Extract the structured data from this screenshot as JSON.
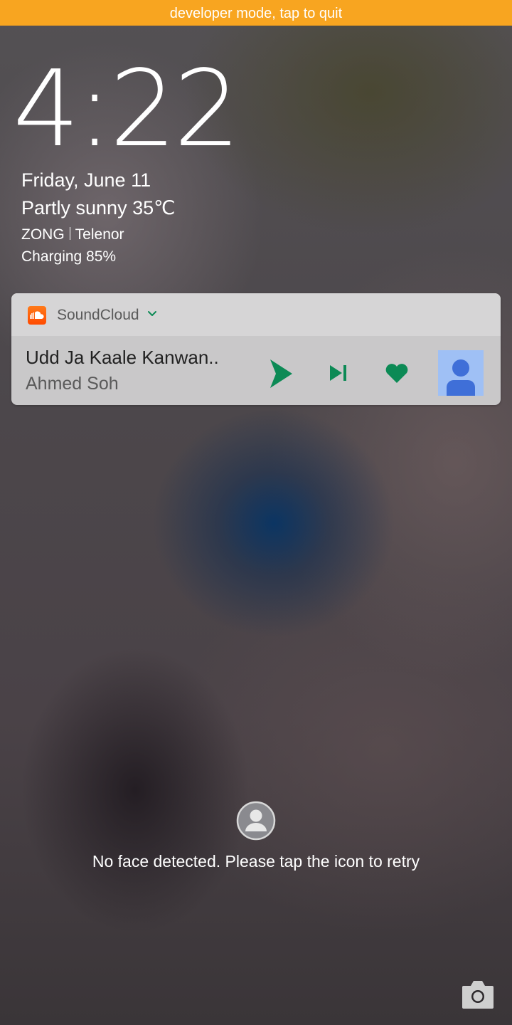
{
  "banner": {
    "text": "developer mode, tap to quit",
    "color": "#f8a520"
  },
  "lockscreen": {
    "time": "4:22",
    "date": "Friday, June 11",
    "weather": "Partly sunny 35℃",
    "carrier_1": "ZONG",
    "carrier_2": "Telenor",
    "charging": "Charging 85%"
  },
  "notification": {
    "app_name": "SoundCloud",
    "app_icon": "soundcloud-logo-icon",
    "track_title": "Udd Ja Kaale Kanwan..",
    "track_artist": "Ahmed Soh",
    "controls": [
      "play-icon",
      "skip-next-icon",
      "heart-icon"
    ],
    "accent_color": "#0c8a55",
    "brand_color": "#ff5500"
  },
  "face_unlock": {
    "icon": "user-avatar-icon",
    "message": "No face detected. Please tap the icon to retry"
  },
  "shortcut": {
    "icon": "camera-icon"
  }
}
